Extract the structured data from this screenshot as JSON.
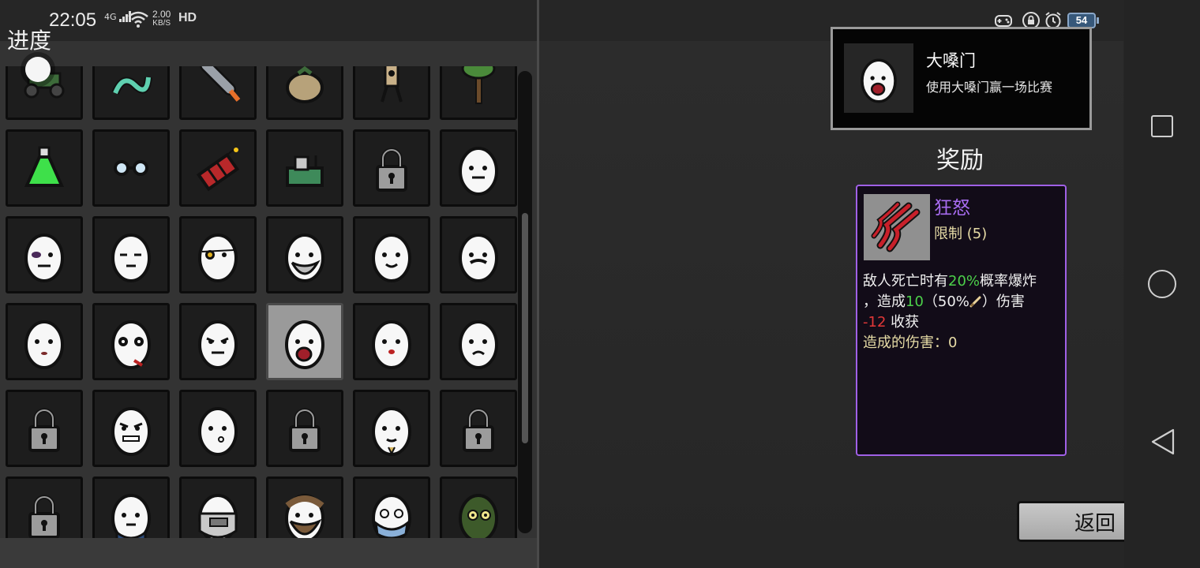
{
  "status_bar": {
    "time": "22:05",
    "network": "4G",
    "speed_top": "2.00",
    "speed_bottom": "KB/S",
    "hd": "HD",
    "battery": "54"
  },
  "left": {
    "title": "进度",
    "grid_icons": [
      "lawnmower-icon",
      "tentacle-icon",
      "rocket-icon",
      "money-bag-icon",
      "scarecrow-icon",
      "tree-icon",
      "potion-icon",
      "glasses-icon",
      "dynamite-icon",
      "machine-icon",
      "lock-icon",
      "character-frown-icon",
      "character-bruised-icon",
      "character-sleepy-icon",
      "character-eyepatch-icon",
      "character-bearded-icon",
      "character-smiling-icon",
      "character-mustache-icon",
      "character-plain-icon",
      "character-panda-icon",
      "character-grumpy-icon",
      "character-loud-icon",
      "character-cheeky-icon",
      "character-sad-icon",
      "lock-icon",
      "character-angry-icon",
      "character-kiss-icon",
      "lock-icon",
      "character-goatee-icon",
      "lock-icon",
      "lock-icon",
      "character-suit-icon",
      "character-helmet-icon",
      "character-bearded-man-icon",
      "character-masked-icon",
      "character-ninja-icon"
    ]
  },
  "achievement": {
    "name": "大嗓门",
    "description": "使用大嗓门赢一场比赛"
  },
  "reward": {
    "title": "奖励",
    "item_name": "狂怒",
    "item_sub": "限制 (5)",
    "desc_line1_a": "敌人死亡时有",
    "desc_line1_b": "20%",
    "desc_line1_c": "概率爆炸",
    "desc_line2_a": "，造成",
    "desc_line2_b": "10",
    "desc_line2_c": "（50%",
    "desc_line2_d": "）伤害",
    "desc_line3_a": "-12",
    "desc_line3_b": " 收获",
    "desc_line4": "造成的伤害：0"
  },
  "back_button": "返回",
  "colors": {
    "item_border": "#a060e6",
    "positive": "#4cd04a",
    "negative": "#e23838"
  }
}
